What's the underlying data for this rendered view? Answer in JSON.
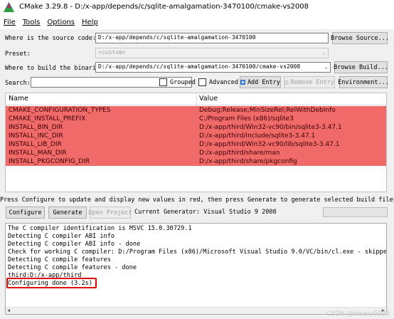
{
  "window": {
    "title": "CMake 3.29.8 - D:/x-app/depends/c/sqlite-amalgamation-3470100/cmake-vs2008"
  },
  "menu": [
    {
      "key": "F",
      "rest": "ile"
    },
    {
      "key": "T",
      "rest": "ools"
    },
    {
      "key": "O",
      "rest": "ptions"
    },
    {
      "key": "H",
      "rest": "elp"
    }
  ],
  "source": {
    "label": "Where is the source code:",
    "value": "D:/x-app/depends/c/sqlite-amalgamation-3470100",
    "browse": "Browse Source..."
  },
  "preset": {
    "label": "Preset:",
    "value": "<custom>"
  },
  "build": {
    "label": "Where to build the binaries:",
    "value": "D:/x-app/depends/c/sqlite-amalgamation-3470100/cmake-vs2008",
    "browse": "Browse Build..."
  },
  "search": {
    "label": "Search:",
    "value": ""
  },
  "options": {
    "grouped": "Grouped",
    "advanced": "Advanced",
    "add_entry": "Add Entry",
    "remove_entry": "Remove Entry",
    "environment": "Environment..."
  },
  "table": {
    "headers": {
      "name": "Name",
      "value": "Value"
    },
    "rows": [
      {
        "name": "CMAKE_CONFIGURATION_TYPES",
        "value": "Debug;Release;MinSizeRel;RelWithDebInfo"
      },
      {
        "name": "CMAKE_INSTALL_PREFIX",
        "value": "C:/Program Files (x86)/sqlite3"
      },
      {
        "name": "INSTALL_BIN_DIR",
        "value": "D:/x-app/third/Win32-vc90/bin/sqlite3-3.47.1"
      },
      {
        "name": "INSTALL_INC_DIR",
        "value": "D:/x-app/third/include/sqlite3-3.47.1"
      },
      {
        "name": "INSTALL_LIB_DIR",
        "value": "D:/x-app/third/Win32-vc90/lib/sqlite3-3.47.1"
      },
      {
        "name": "INSTALL_MAN_DIR",
        "value": "D:/x-app/third/share/man"
      },
      {
        "name": "INSTALL_PKGCONFIG_DIR",
        "value": "D:/x-app/third/share/pkgconfig"
      }
    ],
    "highlight_color": "#f06a6a"
  },
  "hint": "Press Configure to update and display new values in red, then press Generate to generate selected build files.",
  "actions": {
    "configure": "Configure",
    "generate": "Generate",
    "open_project": "Open Project",
    "generator": "Current Generator: Visual Studio 9 2008"
  },
  "output": [
    "The C compiler identification is MSVC 15.0.30729.1",
    "Detecting C compiler ABI info",
    "Detecting C compiler ABI info - done",
    "Check for working C compiler: D:/Program Files (x86)/Microsoft Visual Studio 9.0/VC/bin/cl.exe - skipped",
    "Detecting C compile features",
    "Detecting C compile features - done",
    "third:D:/x-app/third",
    "Configuring done (3.2s)"
  ],
  "watermark": "CSDN @binary0006"
}
